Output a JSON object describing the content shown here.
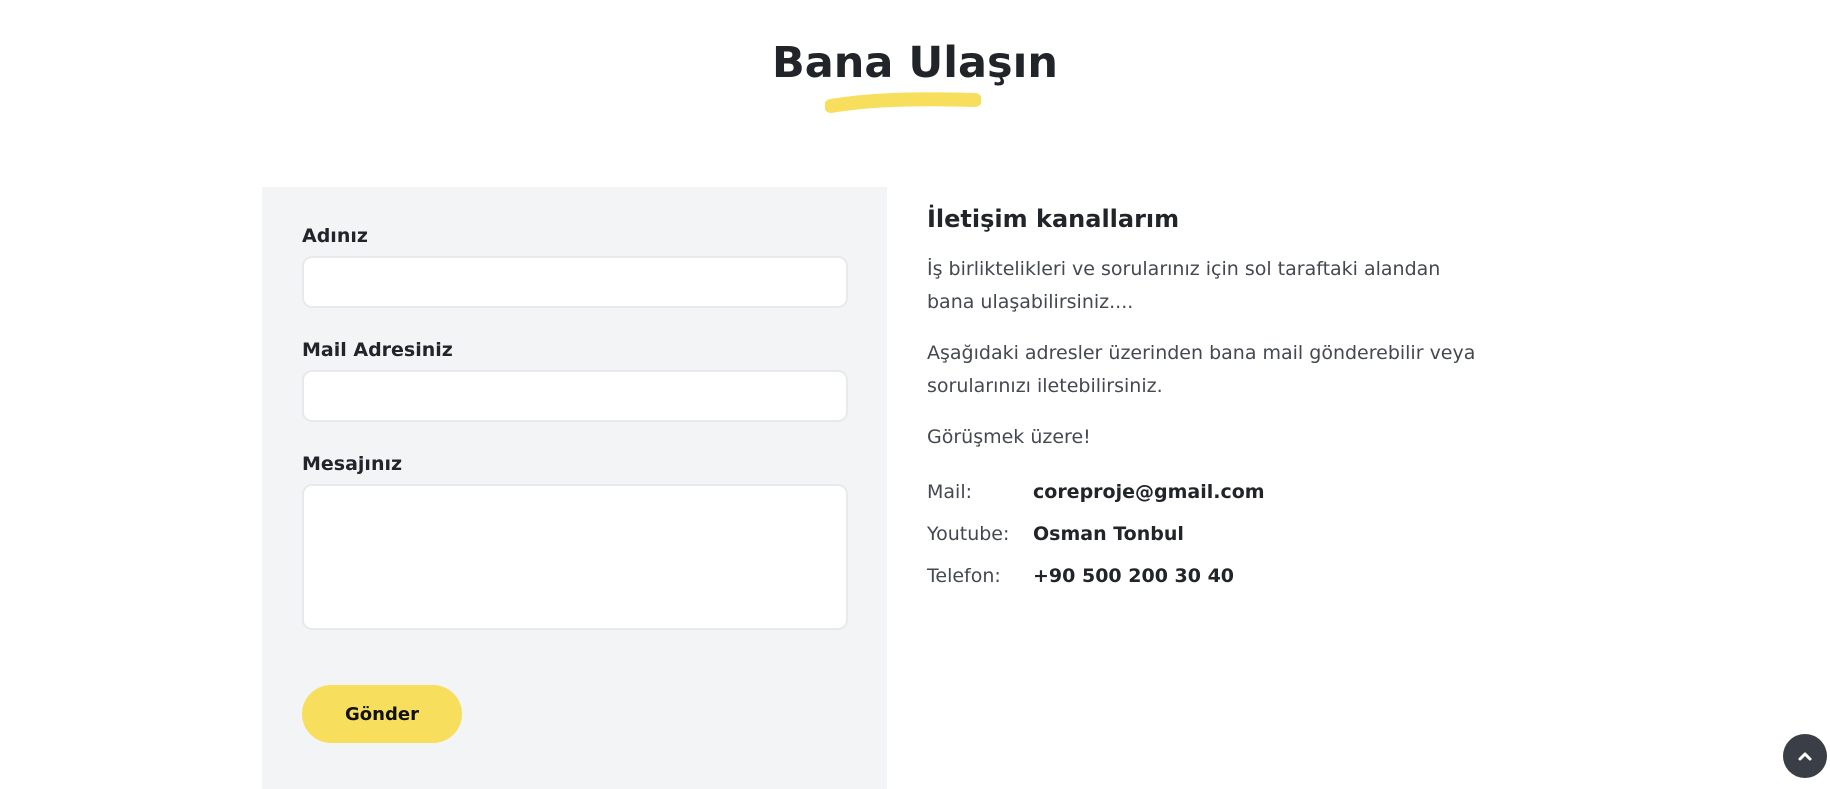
{
  "header": {
    "title": "Bana Ulaşın"
  },
  "form": {
    "name_label": "Adınız",
    "name_value": "",
    "email_label": "Mail Adresiniz",
    "email_value": "",
    "message_label": "Mesajınız",
    "message_value": "",
    "submit_label": "Gönder"
  },
  "info": {
    "heading": "İletişim kanallarım",
    "paragraphs": [
      "İş birliktelikleri ve sorularınız için sol taraftaki alandan bana ulaşabilirsiniz....",
      "Aşağıdaki adresler üzerinden bana mail gönderebilir veya sorularınızı iletebilirsiniz.",
      "Görüşmek üzere!"
    ],
    "contacts": [
      {
        "key": "Mail:",
        "value": "coreproje@gmail.com"
      },
      {
        "key": "Youtube:",
        "value": "Osman Tonbul"
      },
      {
        "key": "Telefon:",
        "value": "+90 500 200 30 40"
      }
    ]
  },
  "icons": {
    "title_underline": "brush-stroke-underline",
    "scroll_top": "chevron-up-icon"
  },
  "colors": {
    "accent": "#f7df5d",
    "panel_bg": "#f3f4f6",
    "scroll_button_bg": "#3a3f47",
    "text_dark": "#212529",
    "text_muted": "#444850"
  }
}
